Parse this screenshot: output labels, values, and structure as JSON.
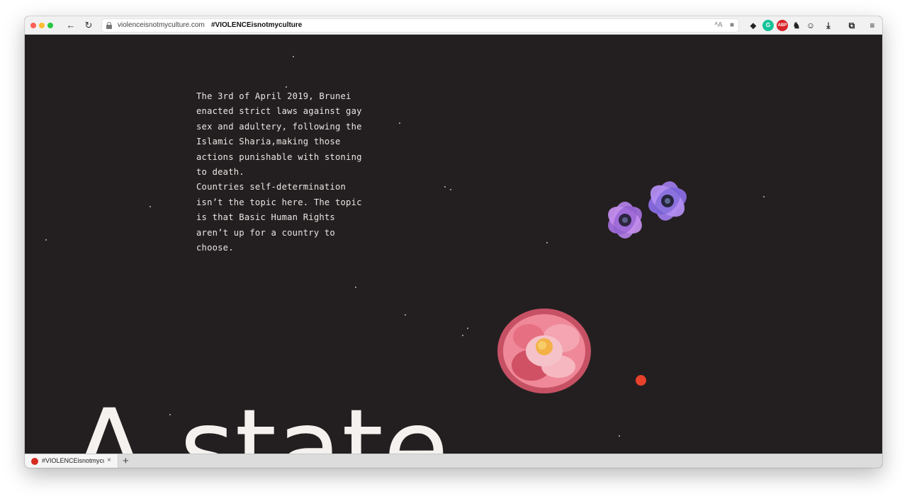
{
  "browser": {
    "url_host": "violenceisnotmyculture.com",
    "page_title": "#VIOLENCEisnotmyculture",
    "back_glyph": "←",
    "reload_glyph": "↻",
    "reader_glyph": "ᴬA",
    "bookmark_glyph": "■",
    "extensions": [
      {
        "name": "bird-extension-icon",
        "glyph": "⬥"
      },
      {
        "name": "grammarly-icon",
        "glyph": "G",
        "color": "#15c39a"
      },
      {
        "name": "adblock-icon",
        "glyph": "ABP",
        "color": "#d82229"
      },
      {
        "name": "horse-extension-icon",
        "glyph": "♞"
      },
      {
        "name": "face-extension-icon",
        "glyph": "☺"
      },
      {
        "name": "downloads-icon",
        "glyph": "⤓"
      },
      {
        "name": "sidebar-icon",
        "glyph": "⧉"
      },
      {
        "name": "menu-icon",
        "glyph": "≡"
      }
    ],
    "tab_label": "#VIOLENCEisnotmyculture",
    "tab_close": "×",
    "new_tab": "+"
  },
  "page": {
    "intro_text": "The 3rd of April 2019, Brunei\nenacted strict laws against gay\nsex and adultery, following the\nIslamic Sharia,making those\nactions punishable with stoning\nto death.\nCountries self-determination\nisn’t the topic here. The topic\nis that Basic Human Rights\naren’t up for a country to\nchoose.",
    "headline_partial": "A state",
    "accent_color": "#e8412c",
    "background_color": "#231f20"
  }
}
